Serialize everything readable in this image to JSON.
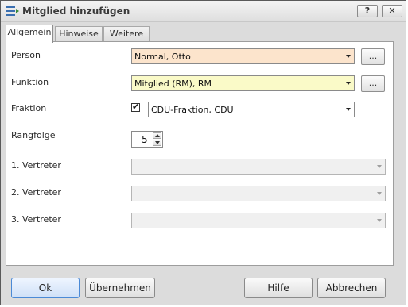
{
  "window": {
    "title": "Mitglied hinzufügen",
    "help_button": "?",
    "close_button": "✕"
  },
  "tabs": [
    {
      "label": "Allgemein",
      "active": true
    },
    {
      "label": "Hinweise",
      "active": false
    },
    {
      "label": "Weitere",
      "active": false
    }
  ],
  "form": {
    "person": {
      "label": "Person",
      "value": "Normal, Otto",
      "background": "#fce4cc"
    },
    "funktion": {
      "label": "Funktion",
      "value": "Mitglied (RM), RM",
      "background": "#fafac8"
    },
    "fraktion": {
      "label": "Fraktion",
      "checked": true,
      "check_glyph": "✔",
      "value": "CDU-Fraktion, CDU"
    },
    "rangfolge": {
      "label": "Rangfolge",
      "value": "5"
    },
    "vertreter1": {
      "label": "1. Vertreter",
      "value": ""
    },
    "vertreter2": {
      "label": "2. Vertreter",
      "value": ""
    },
    "vertreter3": {
      "label": "3. Vertreter",
      "value": ""
    },
    "ellipsis_label": "..."
  },
  "buttons": {
    "ok": "Ok",
    "apply": "Übernehmen",
    "help": "Hilfe",
    "cancel": "Abbrechen"
  },
  "colors": {
    "primary_border": "#4b8ad6"
  }
}
